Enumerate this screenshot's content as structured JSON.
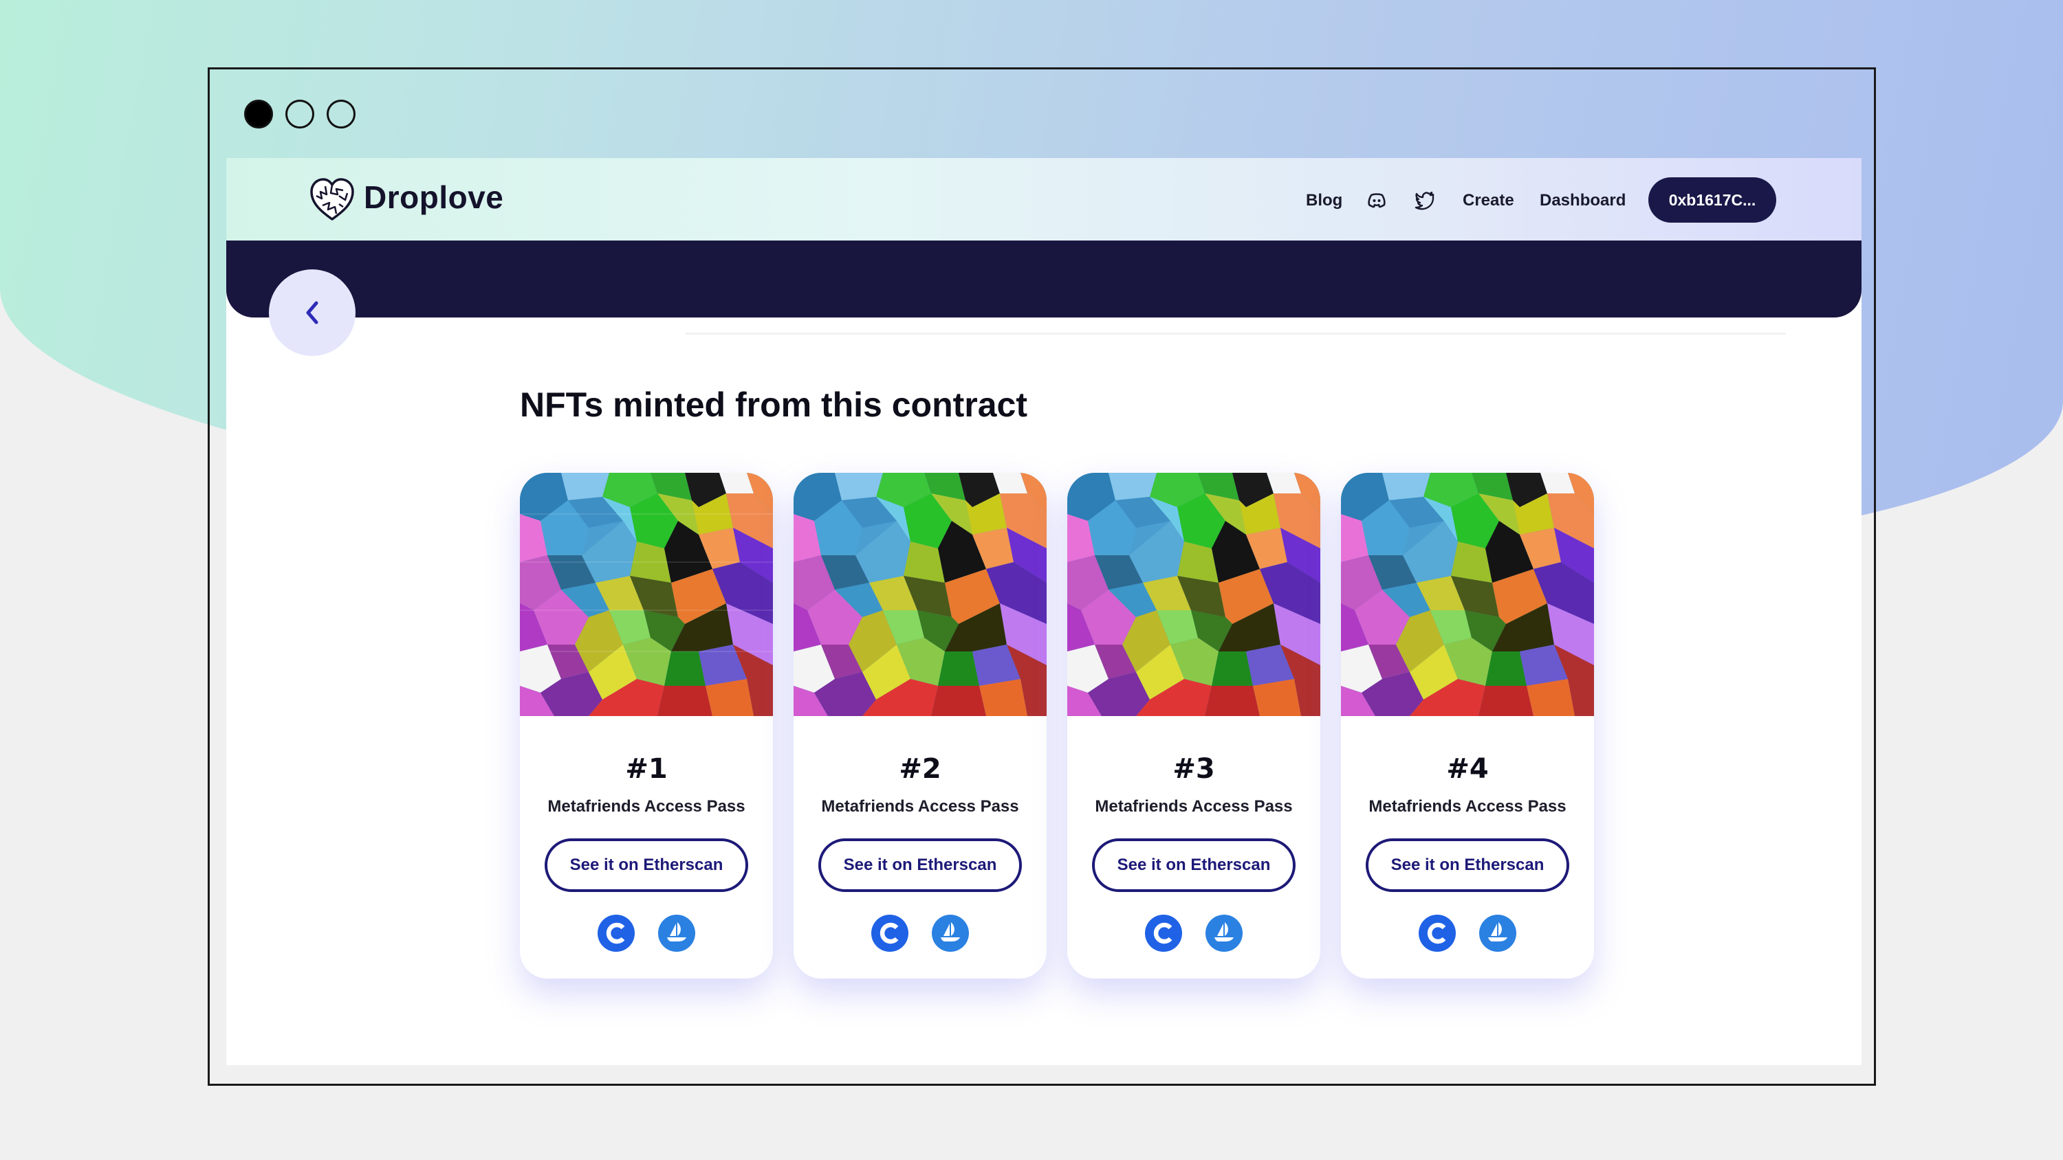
{
  "window": {
    "controls": [
      "close",
      "minimize",
      "maximize"
    ]
  },
  "navbar": {
    "brand": "Droplove",
    "links": {
      "blog": "Blog",
      "create": "Create",
      "dashboard": "Dashboard"
    },
    "icons": [
      "discord-icon",
      "twitter-icon"
    ],
    "wallet": "0xb1617C..."
  },
  "section": {
    "title": "NFTs minted from this contract"
  },
  "cards": [
    {
      "number": "#1",
      "name": "Metafriends Access Pass",
      "button": "See it on Etherscan"
    },
    {
      "number": "#2",
      "name": "Metafriends Access Pass",
      "button": "See it on Etherscan"
    },
    {
      "number": "#3",
      "name": "Metafriends Access Pass",
      "button": "See it on Etherscan"
    },
    {
      "number": "#4",
      "name": "Metafriends Access Pass",
      "button": "See it on Etherscan"
    }
  ],
  "colors": {
    "accent": "#1d1a78",
    "dark": "#18163f",
    "marketplace_blue": "#1f62e6"
  }
}
